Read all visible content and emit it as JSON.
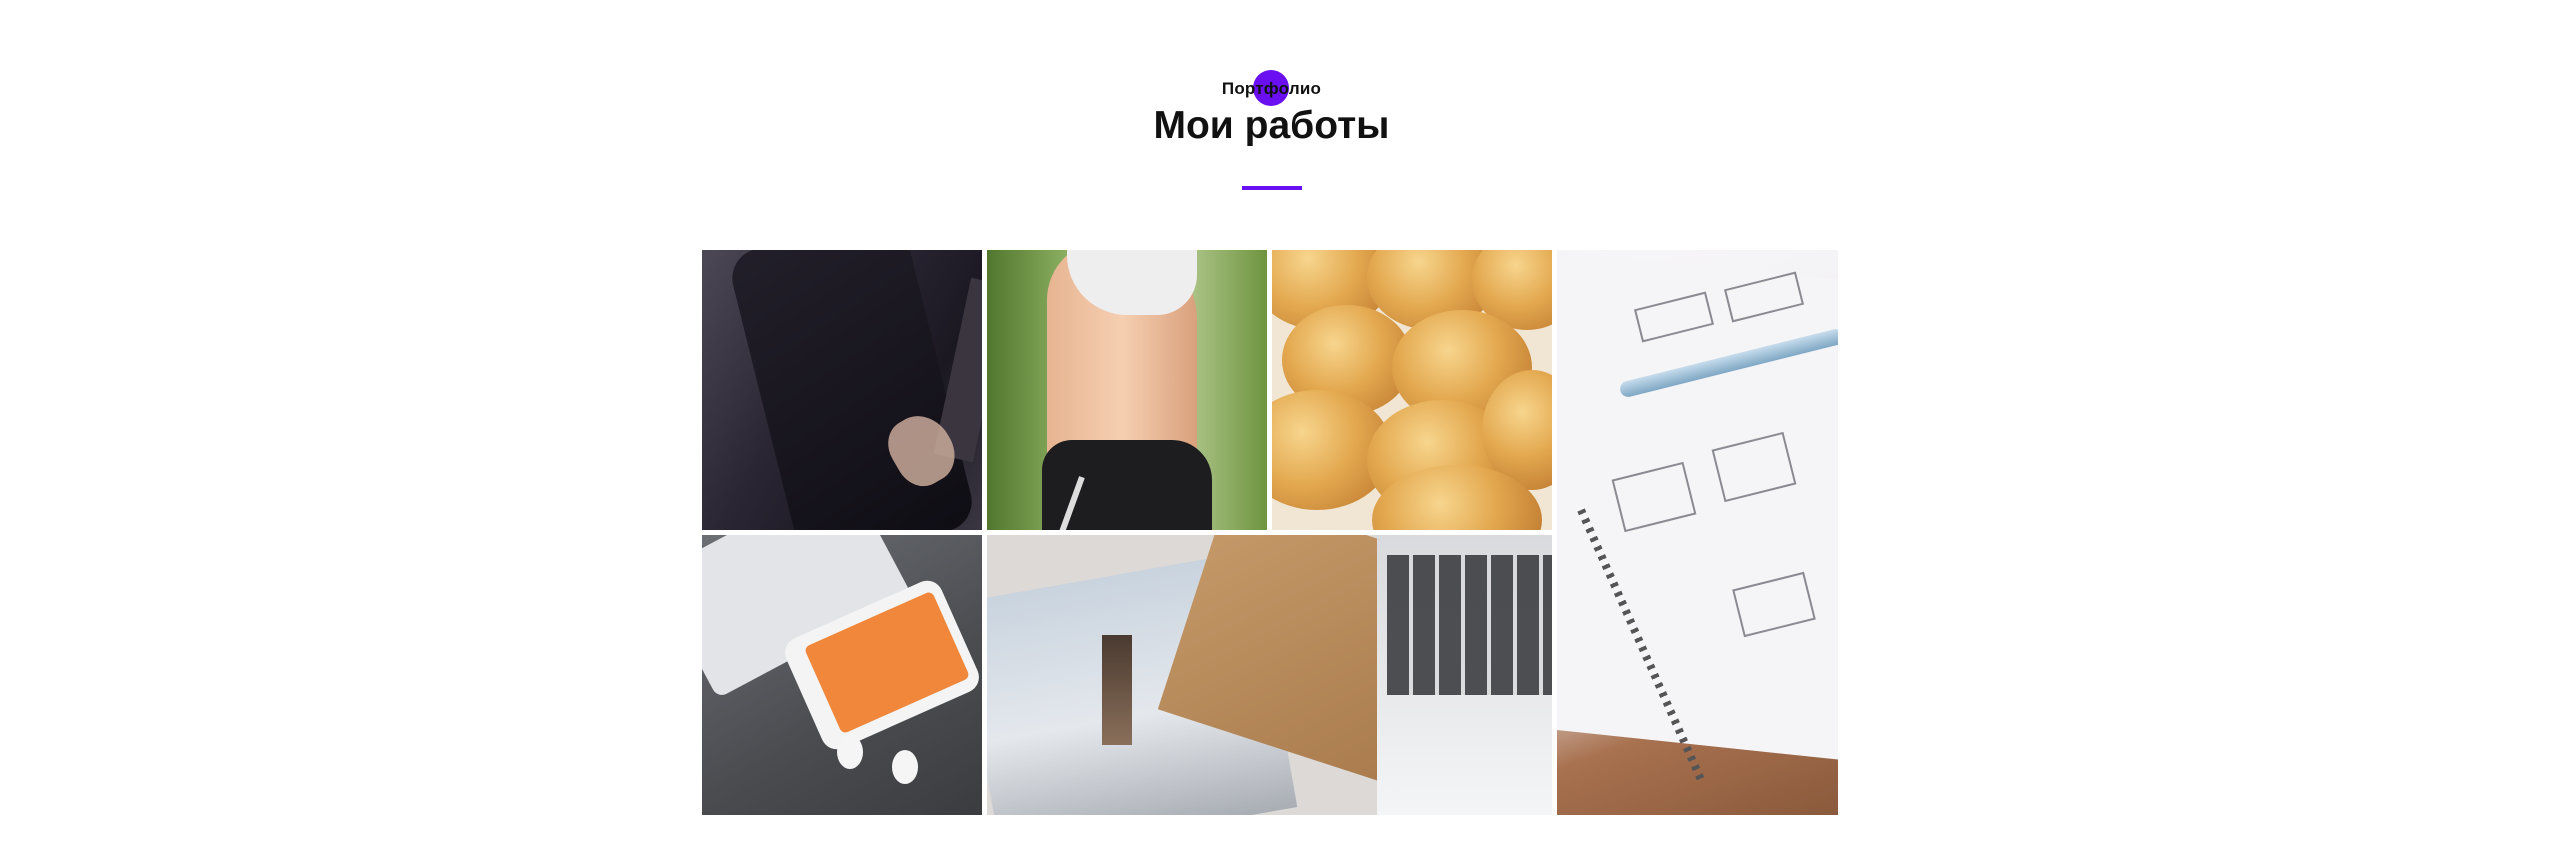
{
  "portfolio": {
    "eyebrow": "Портфолио",
    "title": "Мои работы",
    "accent_color": "#6a0ff2"
  },
  "gallery": {
    "items": [
      {
        "subject": "car-door"
      },
      {
        "subject": "runner"
      },
      {
        "subject": "bread"
      },
      {
        "subject": "wireframe-notebook"
      },
      {
        "subject": "phone-earphones"
      },
      {
        "subject": "lighthouse-photos-laptop"
      }
    ]
  }
}
